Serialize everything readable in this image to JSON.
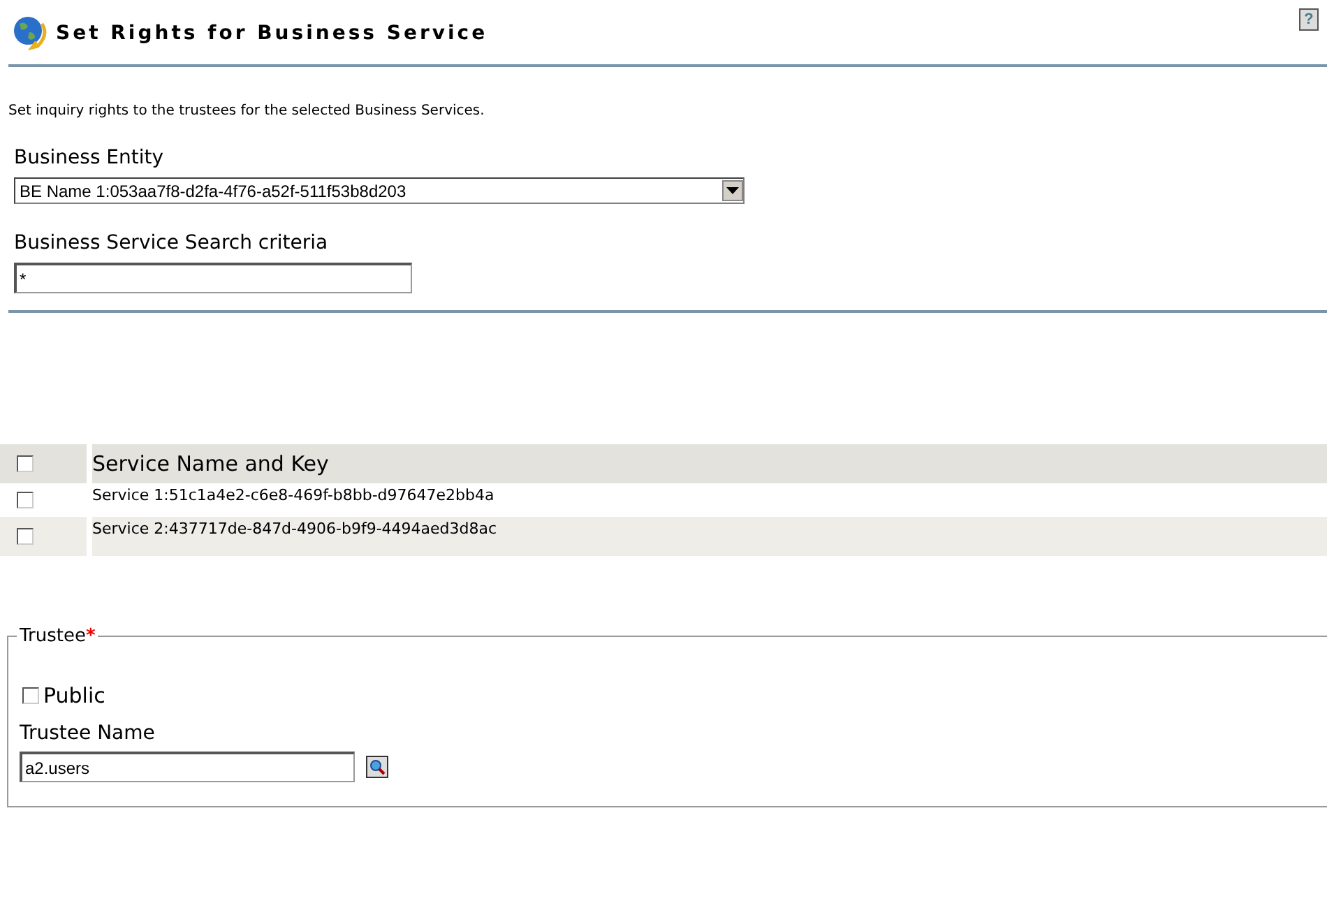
{
  "header": {
    "title": "Set Rights for Business Service",
    "help": "?"
  },
  "description": "Set inquiry rights to the trustees for the selected Business Services.",
  "business_entity": {
    "label": "Business Entity",
    "value": "BE Name 1:053aa7f8-d2fa-4f76-a52f-511f53b8d203"
  },
  "search": {
    "label": "Business Service Search criteria",
    "value": "*"
  },
  "table": {
    "select_all": {
      "checked": false
    },
    "column": "Service Name and Key",
    "rows": [
      {
        "name": "Service 1:51c1a4e2-c6e8-469f-b8bb-d97647e2bb4a",
        "checked": false
      },
      {
        "name": "Service 2:437717de-847d-4906-b9f9-4494aed3d8ac",
        "checked": false
      }
    ]
  },
  "trustee": {
    "legend": "Trustee",
    "required_mark": "*",
    "public": {
      "label": "Public",
      "checked": false
    },
    "name_label": "Trustee Name",
    "name_value": "a2.users"
  }
}
